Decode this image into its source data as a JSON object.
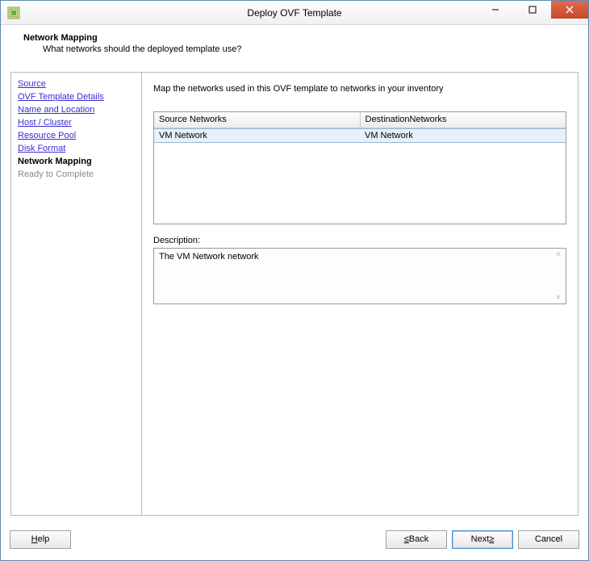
{
  "titlebar": {
    "title": "Deploy OVF Template"
  },
  "header": {
    "title": "Network Mapping",
    "subtitle": "What networks should the deployed template use?"
  },
  "sidebar": {
    "items": [
      {
        "label": "Source",
        "state": "link"
      },
      {
        "label": "OVF Template Details",
        "state": "link"
      },
      {
        "label": "Name and Location",
        "state": "link"
      },
      {
        "label": "Host / Cluster",
        "state": "link"
      },
      {
        "label": "Resource Pool",
        "state": "link"
      },
      {
        "label": "Disk Format",
        "state": "link"
      },
      {
        "label": "Network Mapping",
        "state": "current"
      },
      {
        "label": "Ready to Complete",
        "state": "disabled"
      }
    ]
  },
  "main": {
    "instruction": "Map the networks used in this OVF template to networks in your inventory",
    "table": {
      "col_source": "Source Networks",
      "col_dest": "DestinationNetworks",
      "row_source": "VM Network",
      "row_dest": "VM Network"
    },
    "desc_label": "Description:",
    "desc_text": "The VM Network network"
  },
  "footer": {
    "help": "Help",
    "back_sym": "≤",
    "back_txt": " Back",
    "next_txt": "Next ",
    "next_sym": "≥",
    "cancel": "Cancel"
  }
}
